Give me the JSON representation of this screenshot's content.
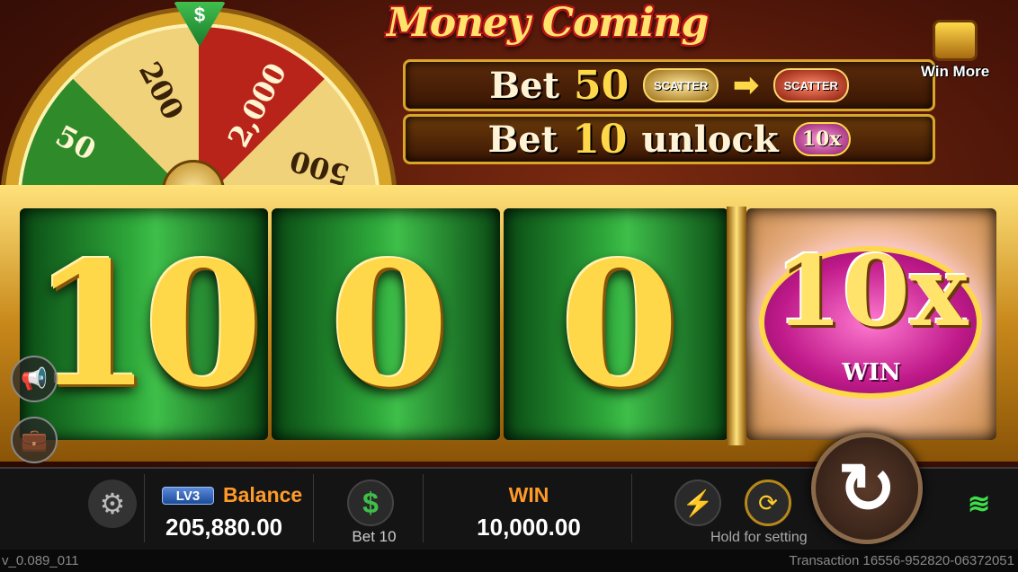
{
  "game": {
    "title": "Money Coming",
    "win_more_label": "Win More"
  },
  "wheel": {
    "pointer_symbol": "$",
    "segments": [
      "50",
      "200",
      "2,000",
      "500"
    ]
  },
  "bet_bars": {
    "bar1": {
      "text": "Bet",
      "amount": "50",
      "from_symbol": "SCATTER",
      "arrow": "➡",
      "to_symbol": "SCATTER"
    },
    "bar2": {
      "text": "Bet",
      "amount": "10",
      "unlock_text": "unlock",
      "chip": "10x"
    }
  },
  "reels": {
    "digits": [
      "10",
      "0",
      "0"
    ],
    "multiplier": "10x",
    "multiplier_sub": "WIN"
  },
  "hud": {
    "level": "LV3",
    "balance_label": "Balance",
    "balance_value": "205,880.00",
    "bet_label": "Bet 10",
    "win_label": "WIN",
    "win_value": "10,000.00",
    "hold_label": "Hold for setting"
  },
  "icons": {
    "gear": "⚙",
    "dollar": "$",
    "turbo": "⚡",
    "auto": "⟳",
    "spin": "↻",
    "wifi": "≋",
    "megaphone": "📢",
    "briefcase": "💼"
  },
  "footer": {
    "version": "v_0.089_011",
    "transaction": "Transaction 16556-952820-06372051"
  },
  "colors": {
    "gold": "#ffd84a",
    "green": "#2ea83a",
    "orange_label": "#ff9a2a"
  }
}
